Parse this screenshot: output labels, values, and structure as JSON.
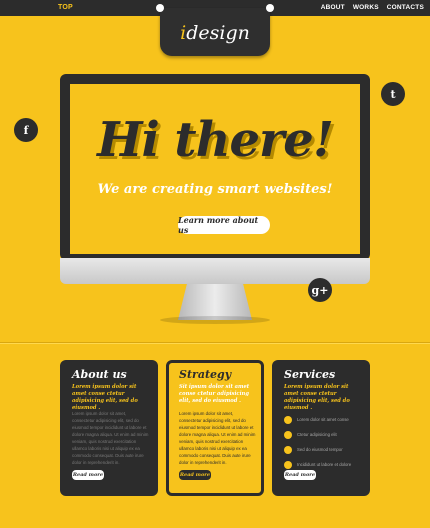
{
  "header": {
    "top_label": "TOP",
    "nav": [
      "ABOUT",
      "WORKS",
      "CONTACTS"
    ],
    "logo": {
      "initial": "i",
      "rest": "design"
    }
  },
  "social": {
    "facebook": "f",
    "twitter": "t",
    "googleplus": "g+"
  },
  "hero": {
    "title": "Hi there!",
    "subtitle": "We are  creating smart websites!",
    "cta": "Learn more about us"
  },
  "cards": [
    {
      "title": "About us",
      "lead": "Lorem ipsum dolor sit amet conse ctetur adipisicing elit, sed do eiusmod .",
      "body": "Lorem ipsum dolor sit amet, consectetur adipisicing elit, sed do eiusmod tempor incididunt ut labore et dolore magna aliqua. Ut enim ad minim veniam, quis nostrud exercitation ullamco laboris nisi ut aliquip ex ea commodo consequat. Duis aute irure dolor in reprehenderit in.",
      "button": "Read more"
    },
    {
      "title": "Strategy",
      "lead": "Sit ipsum dolor sit amet conse ctetur adipisicing elit, sed do eiusmod .",
      "body": "Lorem ipsum dolor sit amet, consectetur adipisicing elit, sed do eiusmod tempor incididunt ut labore et dolore magna aliqua. Ut enim ad minim veniam, quis nostrud exercitation ullamco laboris nisi ut aliquip ex ea commodo consequat. Duis aute irure dolor in reprehenderit in.",
      "button": "Read more"
    },
    {
      "title": "Services",
      "lead": "Lorem ipsum dolor sit amet conse ctetur adipisicing elit, sed do eiusmod .",
      "items": [
        "Lorem dolor sit amet conse",
        "Ctetur adipisicing elit",
        "Sed do eiusmod tempor",
        "Incididunt ut labore et dolore"
      ],
      "button": "Read more"
    }
  ],
  "colors": {
    "brand_yellow": "#f7c31c",
    "dark": "#2c2c2c",
    "white": "#ffffff"
  }
}
